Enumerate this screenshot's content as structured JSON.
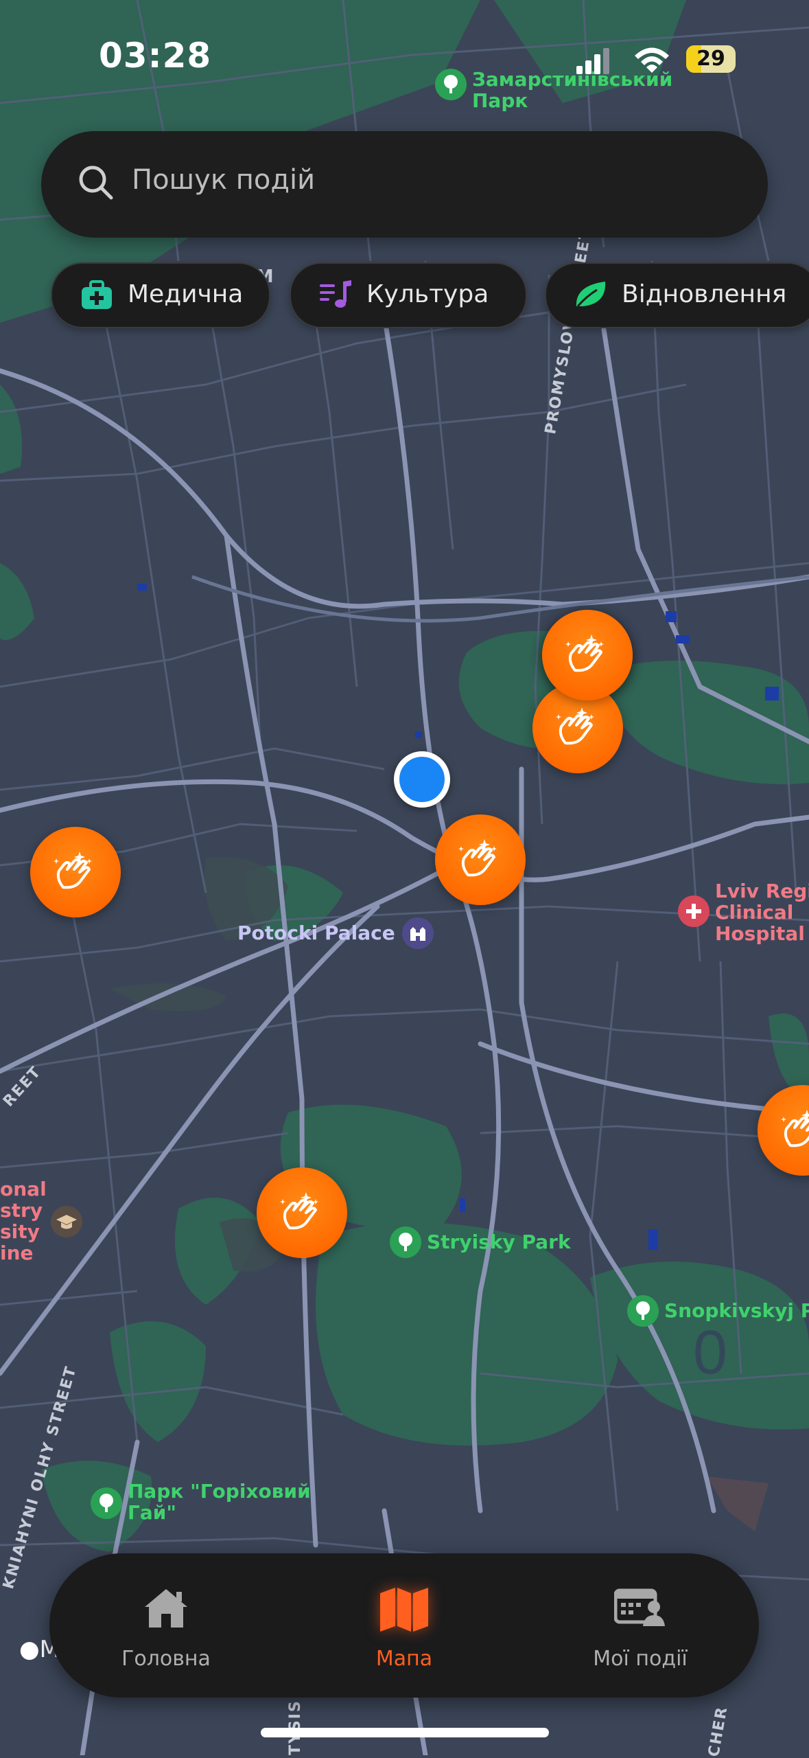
{
  "status_bar": {
    "time": "03:28",
    "battery": "29"
  },
  "search": {
    "placeholder": "Пошук подій",
    "icon": "search-icon"
  },
  "filters": [
    {
      "label": "Медична",
      "icon": "medical-kit-icon",
      "color": "#23c4a0"
    },
    {
      "label": "Культура",
      "icon": "music-list-icon",
      "color": "#a45be0"
    },
    {
      "label": "Відновлення",
      "icon": "leaf-icon",
      "color": "#1fcf74"
    }
  ],
  "map": {
    "event_marker_icon": "clapping-hands-icon",
    "marker_color": "#ff6a00",
    "user_location_color": "#1a85f5",
    "places": [
      {
        "name": "Замарстинівський\nПарк",
        "type": "park",
        "color": "#3fd26c"
      },
      {
        "name": "Potocki Palace",
        "type": "landmark",
        "color": "#b9b7f2"
      },
      {
        "name": "Lviv Regi\nClinical\nHospital",
        "type": "hospital",
        "color": "#f0717c"
      },
      {
        "name": "Stryisky Park",
        "type": "park",
        "color": "#3fd26c"
      },
      {
        "name": "Snopkivskyj Pa",
        "type": "park",
        "color": "#3fd26c"
      },
      {
        "name": "Парк \"Горіховий\nГай\"",
        "type": "park",
        "color": "#3fd26c"
      },
      {
        "name": "onal\nstry\nsity\nine",
        "type": "university",
        "color": "#f0717c"
      }
    ],
    "streets": [
      {
        "name": "PROMYSLOVA STREET"
      },
      {
        "name": "KNIAHYNI OLHY STREET"
      },
      {
        "name": "REET"
      },
      {
        "name": "-M"
      },
      {
        "name": "TYSIS"
      },
      {
        "name": "CHER"
      }
    ],
    "attribution": "M"
  },
  "tab_bar": {
    "tabs": [
      {
        "label": "Головна",
        "icon": "home-icon"
      },
      {
        "label": "Мапа",
        "icon": "map-icon",
        "active": true
      },
      {
        "label": "Мої події",
        "icon": "my-events-icon"
      }
    ]
  }
}
